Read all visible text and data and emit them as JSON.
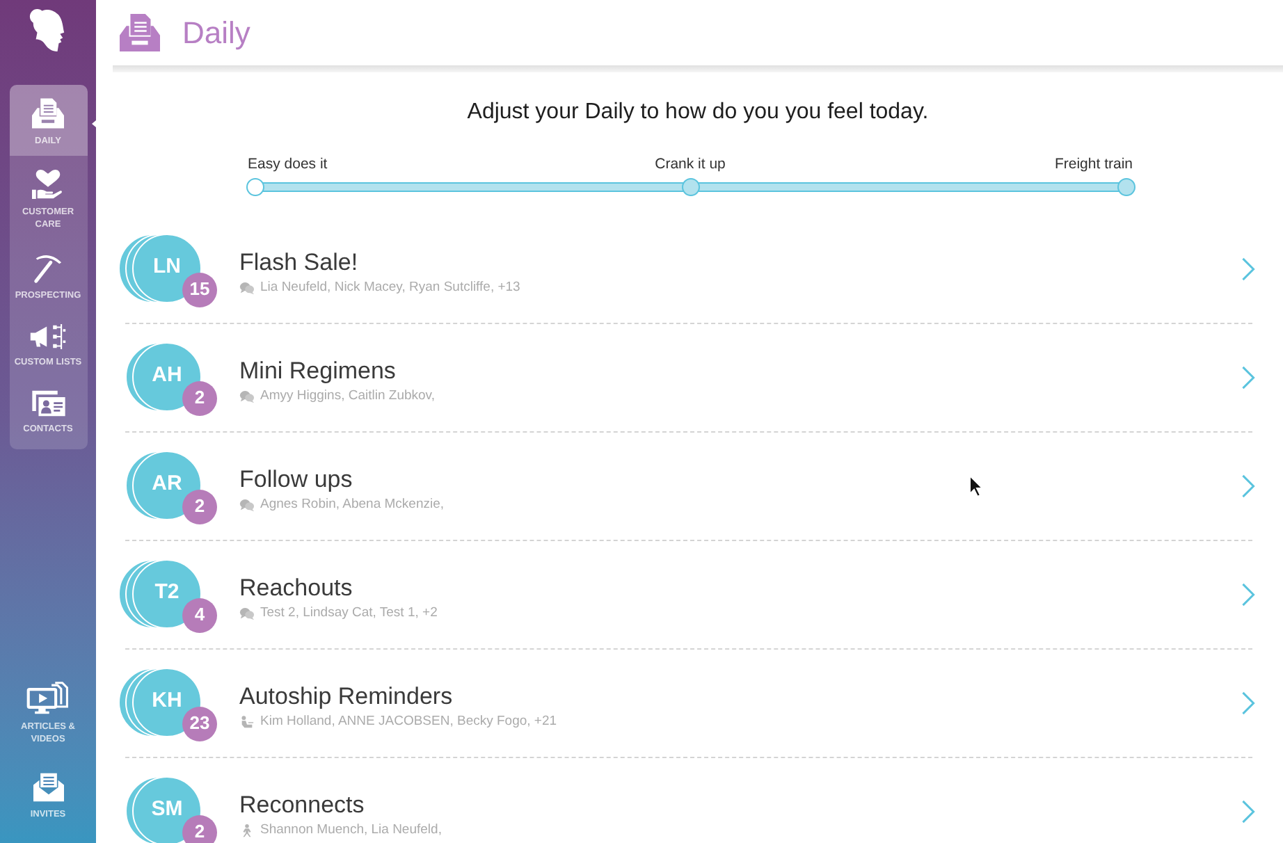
{
  "header": {
    "title": "Daily"
  },
  "sidebar": {
    "items": [
      {
        "label": "DAILY",
        "selected": true
      },
      {
        "label": "CUSTOMER CARE",
        "selected": false
      },
      {
        "label": "PROSPECTING",
        "selected": false
      },
      {
        "label": "CUSTOM LISTS",
        "selected": false
      },
      {
        "label": "CONTACTS",
        "selected": false
      }
    ],
    "bottom_items": [
      {
        "label": "ARTICLES & VIDEOS",
        "selected": false
      },
      {
        "label": "INVITES",
        "selected": false
      }
    ]
  },
  "prompt": "Adjust your Daily to how do you you feel today.",
  "slider": {
    "level": 1,
    "stops": [
      {
        "label": "Easy does it"
      },
      {
        "label": "Crank it up"
      },
      {
        "label": "Freight train"
      }
    ]
  },
  "lists": [
    {
      "title": "Flash Sale!",
      "initials": "LN",
      "count": "15",
      "members": "Lia Neufeld, Nick Macey, Ryan Sutcliffe, +13",
      "kind": "chat",
      "stacked": true
    },
    {
      "title": "Mini Regimens",
      "initials": "AH",
      "count": "2",
      "members": "Amyy Higgins, Caitlin Zubkov,",
      "kind": "chat",
      "stacked": false
    },
    {
      "title": "Follow ups",
      "initials": "AR",
      "count": "2",
      "members": "Agnes Robin, Abena Mckenzie,",
      "kind": "chat",
      "stacked": false
    },
    {
      "title": "Reachouts",
      "initials": "T2",
      "count": "4",
      "members": "Test 2, Lindsay Cat, Test 1, +2",
      "kind": "chat",
      "stacked": true
    },
    {
      "title": "Autoship Reminders",
      "initials": "KH",
      "count": "23",
      "members": "Kim Holland, ANNE JACOBSEN, Becky Fogo, +21",
      "kind": "seated",
      "stacked": true
    },
    {
      "title": "Reconnects",
      "initials": "SM",
      "count": "2",
      "members": "Shannon Muench, Lia Neufeld,",
      "kind": "walking",
      "stacked": false
    }
  ]
}
